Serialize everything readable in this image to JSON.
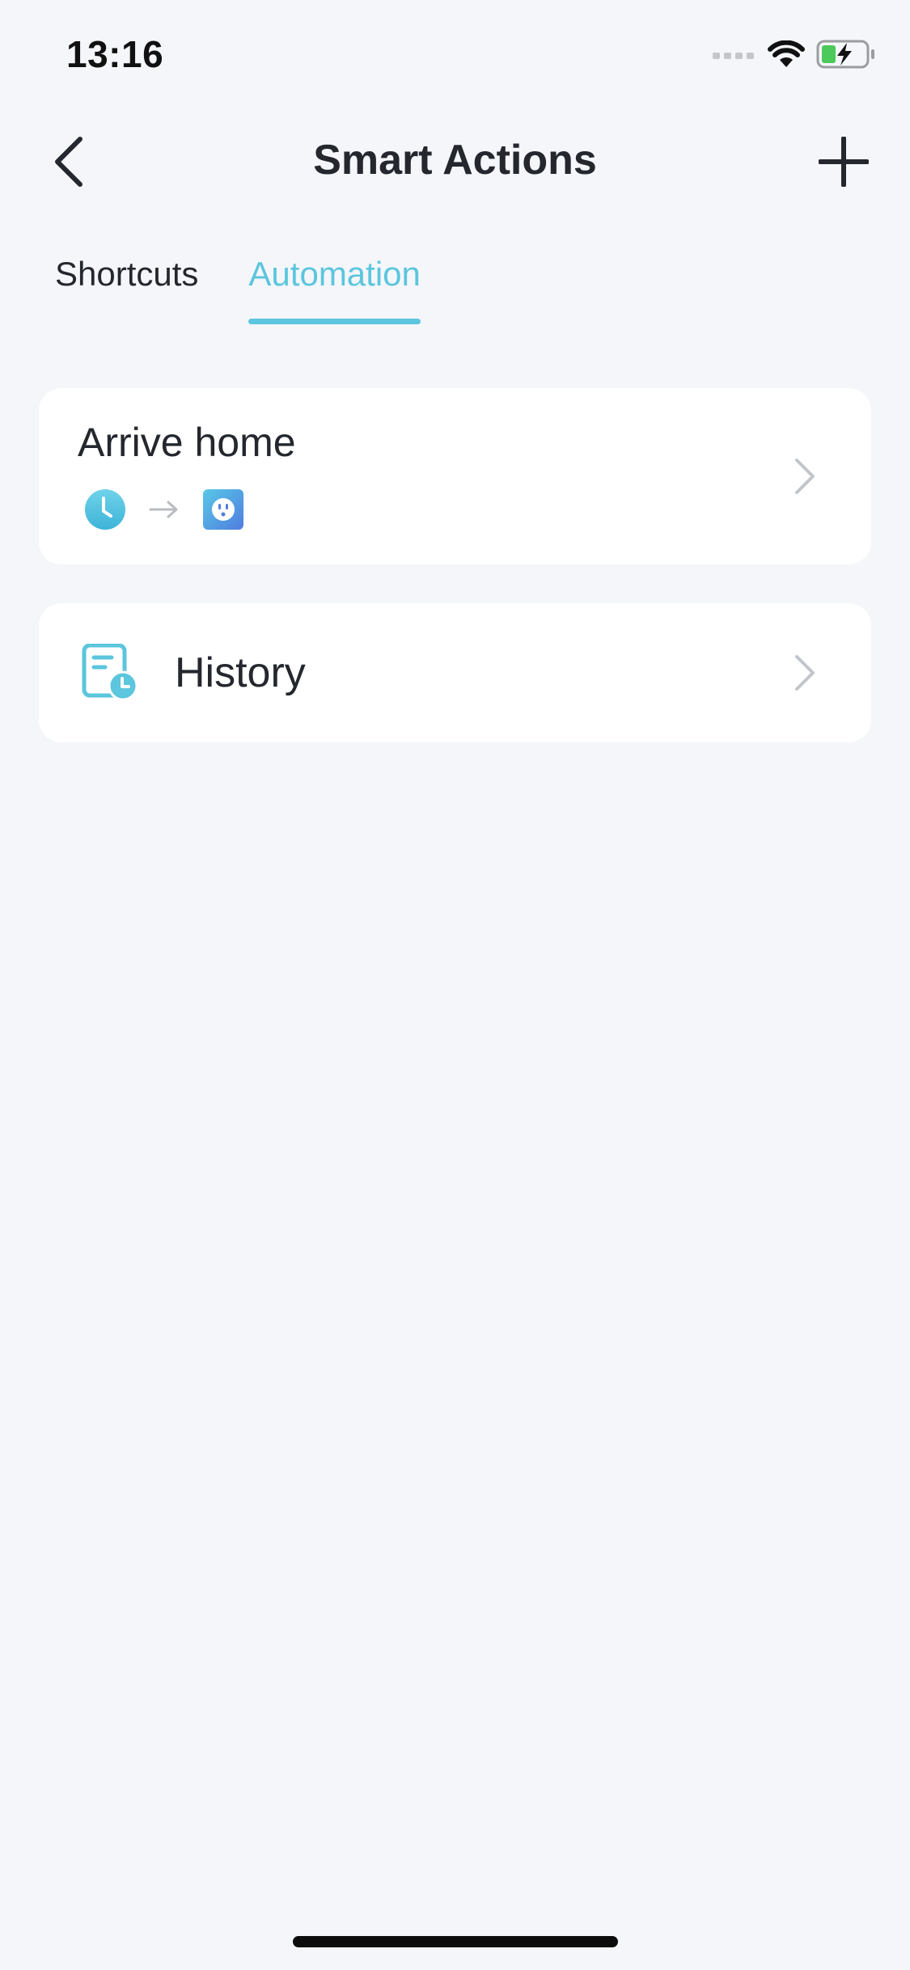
{
  "status_bar": {
    "time": "13:16",
    "icons": [
      "signal-icon",
      "wifi-icon",
      "battery-charging-icon"
    ]
  },
  "nav": {
    "title": "Smart Actions",
    "back_icon": "chevron-left-icon",
    "add_icon": "plus-icon"
  },
  "tabs": [
    {
      "label": "Shortcuts",
      "active": false
    },
    {
      "label": "Automation",
      "active": true
    }
  ],
  "automations": [
    {
      "title": "Arrive home",
      "trigger_icon": "clock-icon",
      "arrow_icon": "arrow-right-icon",
      "action_icon": "smart-plug-icon"
    }
  ],
  "history": {
    "label": "History",
    "icon": "history-document-icon"
  },
  "colors": {
    "accent": "#5bc6dd",
    "background": "#f4f6fa",
    "card": "#ffffff",
    "text": "#24272d",
    "plug_gradient_start": "#58c8e6",
    "plug_gradient_end": "#4f7de0"
  }
}
